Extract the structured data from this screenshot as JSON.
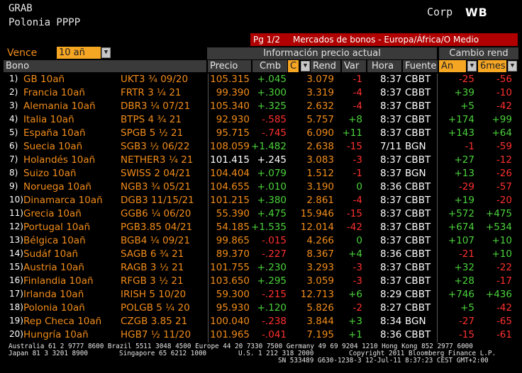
{
  "header": {
    "title": "GRAB",
    "subtitle": "Polonia PPPP",
    "corp": "Corp",
    "logo": "WB",
    "page": "Pg 1/2",
    "screen_title": "Mercados de bonos - Europa/África/O Medio"
  },
  "controls": {
    "vence_label": "Vence",
    "vence_value": "10 añ",
    "info_header": "Información precio actual",
    "cambio_header": "Cambio rend"
  },
  "columns": {
    "bono": "Bono",
    "precio": "Precio",
    "cmb": "Cmb",
    "c": "C",
    "rend": "Rend",
    "var": "Var",
    "hora": "Hora",
    "fuente": "Fuente",
    "an": "An",
    "meses": "6mes"
  },
  "rows": [
    {
      "n": "1)",
      "bono": "GB 10añ",
      "ticker": "UKT3 ¾ 09/20",
      "precio": "105.315",
      "cmb": "+.045",
      "rend": "3.079",
      "var": "-1",
      "hora": "8:37",
      "fuente": "CBBT",
      "an": "-25",
      "meses": "-56"
    },
    {
      "n": "2)",
      "bono": "Francia 10añ",
      "ticker": "FRTR 3 ¼ 21",
      "precio": "99.390",
      "cmb": "+.300",
      "rend": "3.319",
      "var": "-4",
      "hora": "8:37",
      "fuente": "CBBT",
      "an": "+39",
      "meses": "-10"
    },
    {
      "n": "3)",
      "bono": "Alemania 10añ",
      "ticker": "DBR3 ¼ 07/21",
      "precio": "105.340",
      "cmb": "+.325",
      "rend": "2.632",
      "var": "-4",
      "hora": "8:37",
      "fuente": "CBBT",
      "an": "+5",
      "meses": "-42"
    },
    {
      "n": "4)",
      "bono": "Italia 10añ",
      "ticker": "BTPS 4 ¾ 21",
      "precio": "92.930",
      "cmb": "-.585",
      "rend": "5.757",
      "var": "+8",
      "hora": "8:37",
      "fuente": "CBBT",
      "an": "+174",
      "meses": "+99"
    },
    {
      "n": "5)",
      "bono": "España 10añ",
      "ticker": "SPGB 5 ½ 21",
      "precio": "95.715",
      "cmb": "-.745",
      "rend": "6.090",
      "var": "+11",
      "hora": "8:37",
      "fuente": "CBBT",
      "an": "+143",
      "meses": "+64"
    },
    {
      "n": "6)",
      "bono": "Suecia 10añ",
      "ticker": "SGB3 ½ 06/22",
      "precio": "108.059",
      "cmb": "+1.482",
      "rend": "2.638",
      "var": "-15",
      "hora": "7/11",
      "fuente": "BGN",
      "an": "-1",
      "meses": "-59"
    },
    {
      "n": "7)",
      "bono": "Holandés 10añ",
      "ticker": "NETHER3 ¼ 21",
      "precio": "101.415",
      "cmb": "+.245",
      "rend": "3.083",
      "var": "-3",
      "hora": "8:37",
      "fuente": "CBBT",
      "an": "+27",
      "meses": "-12"
    },
    {
      "n": "8)",
      "bono": "Suizo 10añ",
      "ticker": "SWISS 2 04/21",
      "precio": "104.404",
      "cmb": "+.079",
      "rend": "1.512",
      "var": "-1",
      "hora": "8:37",
      "fuente": "BGN",
      "an": "+13",
      "meses": "-26"
    },
    {
      "n": "9)",
      "bono": "Noruega 10añ",
      "ticker": "NGB3 ¾ 05/21",
      "precio": "104.655",
      "cmb": "+.010",
      "rend": "3.190",
      "var": "0",
      "hora": "8:36",
      "fuente": "CBBT",
      "an": "-29",
      "meses": "-57"
    },
    {
      "n": "10)",
      "bono": "Dinamarca 10añ",
      "ticker": "DGB3 11/15/21",
      "precio": "101.215",
      "cmb": "+.380",
      "rend": "2.861",
      "var": "-4",
      "hora": "8:37",
      "fuente": "CBBT",
      "an": "+19",
      "meses": "-20"
    },
    {
      "n": "11)",
      "bono": "Grecia 10añ",
      "ticker": "GGB6 ¼ 06/20",
      "precio": "55.390",
      "cmb": "+.475",
      "rend": "15.946",
      "var": "-15",
      "hora": "8:37",
      "fuente": "CBBT",
      "an": "+572",
      "meses": "+475"
    },
    {
      "n": "12)",
      "bono": "Portugal 10añ",
      "ticker": "PGB3.85 04/21",
      "precio": "54.185",
      "cmb": "+1.535",
      "rend": "12.014",
      "var": "-42",
      "hora": "8:37",
      "fuente": "CBBT",
      "an": "+674",
      "meses": "+534"
    },
    {
      "n": "13)",
      "bono": "Bélgica 10añ",
      "ticker": "BGB4 ¼ 09/21",
      "precio": "99.865",
      "cmb": "-.015",
      "rend": "4.266",
      "var": "0",
      "hora": "8:37",
      "fuente": "CBBT",
      "an": "+107",
      "meses": "+10"
    },
    {
      "n": "14)",
      "bono": "Sudáf 10añ",
      "ticker": "SAGB 6 ¾ 21",
      "precio": "89.370",
      "cmb": "-.227",
      "rend": "8.367",
      "var": "+4",
      "hora": "8:36",
      "fuente": "CBBT",
      "an": "-21",
      "meses": "+10"
    },
    {
      "n": "15)",
      "bono": "Austria 10añ",
      "ticker": "RAGB 3 ½ 21",
      "precio": "101.755",
      "cmb": "+.230",
      "rend": "3.293",
      "var": "-3",
      "hora": "8:37",
      "fuente": "CBBT",
      "an": "+32",
      "meses": "-22"
    },
    {
      "n": "16)",
      "bono": "Finlandia 10añ",
      "ticker": "RFGB 3 ½ 21",
      "precio": "103.650",
      "cmb": "+.295",
      "rend": "3.059",
      "var": "-3",
      "hora": "8:37",
      "fuente": "CBBT",
      "an": "+28",
      "meses": "-17"
    },
    {
      "n": "17)",
      "bono": "Irlanda 10añ",
      "ticker": "IRISH 5 10/20",
      "precio": "59.300",
      "cmb": "-.215",
      "rend": "12.713",
      "var": "+6",
      "hora": "8:29",
      "fuente": "CBBT",
      "an": "+746",
      "meses": "+436"
    },
    {
      "n": "18)",
      "bono": "Polonia 10añ",
      "ticker": "POLGB 5 ¼ 20",
      "precio": "95.930",
      "cmb": "+.120",
      "rend": "5.826",
      "var": "-2",
      "hora": "8:27",
      "fuente": "CBBT",
      "an": "+5",
      "meses": "-42"
    },
    {
      "n": "19)",
      "bono": "Rep Checa 10añ",
      "ticker": "CZGB 3.85 21",
      "precio": "100.040",
      "cmb": "-.238",
      "rend": "3.844",
      "var": "+3",
      "hora": "8:34",
      "fuente": "BGN",
      "an": "-27",
      "meses": "-65"
    },
    {
      "n": "20)",
      "bono": "Hungría 10añ",
      "ticker": "HGB7 ½ 11/20",
      "precio": "101.965",
      "cmb": "-.041",
      "rend": "7.195",
      "var": "+1",
      "hora": "8:36",
      "fuente": "CBBT",
      "an": "-15",
      "meses": "-61"
    }
  ],
  "footer": {
    "line1": "Australia 61 2 9777 8600 Brazil 5511 3048 4500 Europe 44 20 7330 7500 Germany 49 69 9204 1210 Hong Kong 852 2977 6000",
    "line2a": "Japan 81 3 3201 8900",
    "line2b": "Singapore 65 6212 1000",
    "line2c": "U.S. 1 212 318 2000",
    "line2d": "Copyright 2011 Bloomberg Finance L.P.",
    "line3": "SN 533489 G630-1238-3 12-Jul-11  8:37:23 CEST GMT+2:00"
  },
  "colors": {
    "accent_orange": "#f5a623",
    "positive": "#4cd23c",
    "negative": "#ff3030",
    "title_bar": "#b00000"
  }
}
